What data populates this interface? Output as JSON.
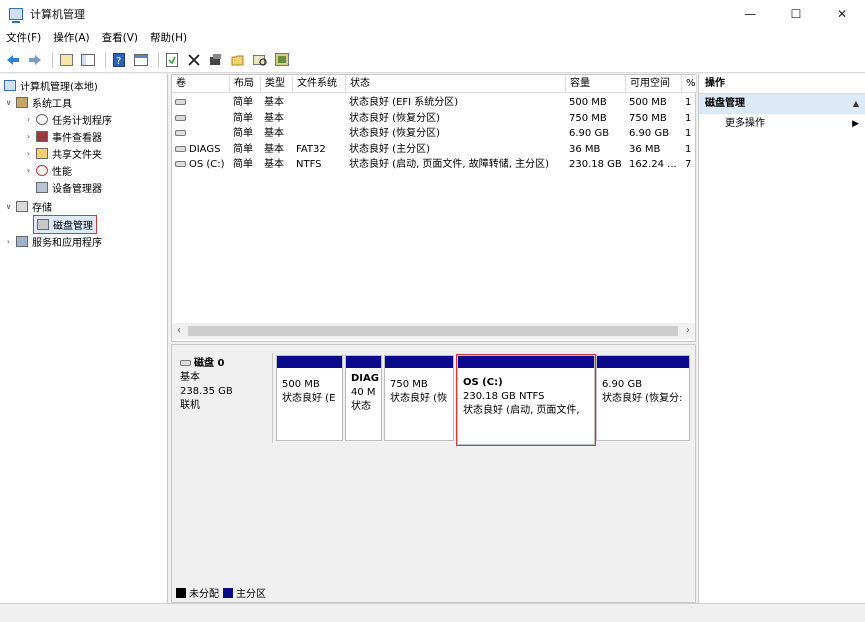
{
  "window": {
    "title": "计算机管理",
    "min": "—",
    "max": "☐",
    "close": "✕"
  },
  "menu": [
    "文件(F)",
    "操作(A)",
    "查看(V)",
    "帮助(H)"
  ],
  "tree": {
    "root": "计算机管理(本地)",
    "system_tools": "系统工具",
    "task_scheduler": "任务计划程序",
    "event_viewer": "事件查看器",
    "shared_folders": "共享文件夹",
    "performance": "性能",
    "device_manager": "设备管理器",
    "storage": "存储",
    "disk_management": "磁盘管理",
    "services_apps": "服务和应用程序"
  },
  "volume_table": {
    "headers": [
      "卷",
      "布局",
      "类型",
      "文件系统",
      "状态",
      "容量",
      "可用空间",
      "%"
    ],
    "rows": [
      [
        "",
        "简单",
        "基本",
        "",
        "状态良好 (EFI 系统分区)",
        "500 MB",
        "500 MB",
        "1"
      ],
      [
        "",
        "简单",
        "基本",
        "",
        "状态良好 (恢复分区)",
        "750 MB",
        "750 MB",
        "1"
      ],
      [
        "",
        "简单",
        "基本",
        "",
        "状态良好 (恢复分区)",
        "6.90 GB",
        "6.90 GB",
        "1"
      ],
      [
        "DIAGS",
        "简单",
        "基本",
        "FAT32",
        "状态良好 (主分区)",
        "36 MB",
        "36 MB",
        "1"
      ],
      [
        "OS (C:)",
        "简单",
        "基本",
        "NTFS",
        "状态良好 (启动, 页面文件, 故障转储, 主分区)",
        "230.18 GB",
        "162.24 ...",
        "7"
      ]
    ]
  },
  "disk": {
    "name": "磁盘 0",
    "type": "基本",
    "size": "238.35 GB",
    "state": "联机",
    "partitions": [
      {
        "title": "",
        "size": "500 MB",
        "status": "状态良好 (E"
      },
      {
        "title": "DIAG",
        "size": "40 M",
        "status": "状态"
      },
      {
        "title": "",
        "size": "750 MB",
        "status": "状态良好 (恢"
      },
      {
        "title": "OS  (C:)",
        "size": "230.18 GB NTFS",
        "status": "状态良好 (启动, 页面文件,"
      },
      {
        "title": "",
        "size": "6.90 GB",
        "status": "状态良好 (恢复分:"
      }
    ]
  },
  "legend": {
    "unallocated": "未分配",
    "primary": "主分区"
  },
  "actions": {
    "header": "操作",
    "section": "磁盘管理",
    "more": "更多操作"
  },
  "colors": {
    "primary_partition": "#0a0a8a",
    "unallocated": "#000000",
    "highlight": "#d23b3b"
  }
}
